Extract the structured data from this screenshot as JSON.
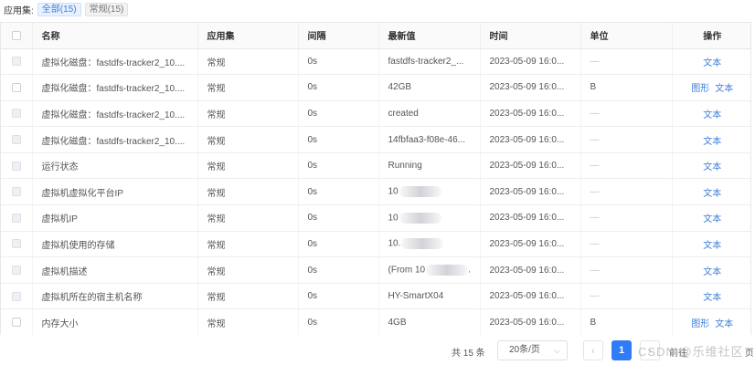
{
  "filter": {
    "label": "应用集:",
    "chips": [
      {
        "text": "全部(15)",
        "active": true
      },
      {
        "text": "常规(15)",
        "active": false
      }
    ]
  },
  "table": {
    "headers": [
      "名称",
      "应用集",
      "间隔",
      "最新值",
      "时间",
      "单位",
      "操作"
    ],
    "rows": [
      {
        "name": "虚拟化磁盘：fastdfs-tracker2_10....",
        "app": "常规",
        "interval": "0s",
        "value": "fastdfs-tracker2_...",
        "blurred": false,
        "time": "2023-05-09 16:0...",
        "unit": "—",
        "ops": [
          "文本"
        ]
      },
      {
        "name": "虚拟化磁盘：fastdfs-tracker2_10....",
        "app": "常规",
        "interval": "0s",
        "value": "42GB",
        "blurred": false,
        "time": "2023-05-09 16:0...",
        "unit": "B",
        "ops": [
          "图形",
          "文本"
        ]
      },
      {
        "name": "虚拟化磁盘：fastdfs-tracker2_10....",
        "app": "常规",
        "interval": "0s",
        "value": "created",
        "blurred": false,
        "time": "2023-05-09 16:0...",
        "unit": "—",
        "ops": [
          "文本"
        ]
      },
      {
        "name": "虚拟化磁盘：fastdfs-tracker2_10....",
        "app": "常规",
        "interval": "0s",
        "value": "14fbfaa3-f08e-46...",
        "blurred": false,
        "time": "2023-05-09 16:0...",
        "unit": "—",
        "ops": [
          "文本"
        ]
      },
      {
        "name": "运行状态",
        "app": "常规",
        "interval": "0s",
        "value": "Running",
        "blurred": false,
        "time": "2023-05-09 16:0...",
        "unit": "—",
        "ops": [
          "文本"
        ]
      },
      {
        "name": "虚拟机虚拟化平台IP",
        "app": "常规",
        "interval": "0s",
        "value": "10",
        "blurred": true,
        "time": "2023-05-09 16:0...",
        "unit": "—",
        "ops": [
          "文本"
        ]
      },
      {
        "name": "虚拟机IP",
        "app": "常规",
        "interval": "0s",
        "value": "10",
        "blurred": true,
        "time": "2023-05-09 16:0...",
        "unit": "—",
        "ops": [
          "文本"
        ]
      },
      {
        "name": "虚拟机使用的存储",
        "app": "常规",
        "interval": "0s",
        "value": "10.",
        "blurred": true,
        "time": "2023-05-09 16:0...",
        "unit": "—",
        "ops": [
          "文本"
        ]
      },
      {
        "name": "虚拟机描述",
        "app": "常规",
        "interval": "0s",
        "value": "(From 10",
        "blurred": true,
        "value_tail": ".",
        "time": "2023-05-09 16:0...",
        "unit": "—",
        "ops": [
          "文本"
        ]
      },
      {
        "name": "虚拟机所在的宿主机名称",
        "app": "常规",
        "interval": "0s",
        "value": "HY-SmartX04",
        "blurred": false,
        "time": "2023-05-09 16:0...",
        "unit": "—",
        "ops": [
          "文本"
        ]
      },
      {
        "name": "内存大小",
        "app": "常规",
        "interval": "0s",
        "value": "4GB",
        "blurred": false,
        "time": "2023-05-09 16:0...",
        "unit": "B",
        "ops": [
          "图形",
          "文本"
        ]
      }
    ]
  },
  "pagination": {
    "total": "共 15 条",
    "page_size": "20条/页",
    "prev": "‹",
    "current_page": "1",
    "next": "›",
    "goto": "前往",
    "goto_tail": "页"
  },
  "watermark": "CSDN @乐维社区",
  "colors": {
    "accent": "#2f7cf6",
    "link": "#3d7ddb"
  }
}
